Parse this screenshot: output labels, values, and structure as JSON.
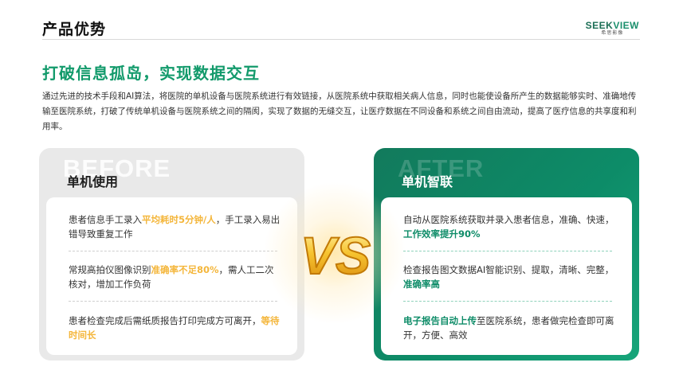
{
  "header": {
    "title": "产品优势",
    "logo": {
      "main_prefix": "SEEK",
      "main_suffix": "VIEW",
      "sub": "希思影像"
    }
  },
  "headline": "打破信息孤岛，实现数据交互",
  "intro": "通过先进的技术手段和AI算法，将医院的单机设备与医院系统进行有效链接，从医院系统中获取相关病人信息，同时也能使设备所产生的数据能够实时、准确地传输至医院系统，打破了传统单机设备与医院系统之间的隔阂，实现了数据的无缝交互，让医疗数据在不同设备和系统之间自由流动，提高了医疗信息的共享度和利用率。",
  "before": {
    "ghost": "BEFORE",
    "title": "单机使用",
    "items": [
      {
        "pre": "患者信息手工录入",
        "hl": "平均耗时5分钟/人",
        "post": "，手工录入易出错导致重复工作"
      },
      {
        "pre": "常规高拍仪图像识别",
        "hl": "准确率不足80%",
        "post": "，需人工二次核对，增加工作负荷"
      },
      {
        "pre": "患者检查完成后需纸质报告打印完成方可离开，",
        "hl": "等待时间长",
        "post": ""
      }
    ]
  },
  "after": {
    "ghost": "AFTER",
    "title": "单机智联",
    "items": [
      {
        "pre": "自动从医院系统获取并录入患者信息，准确、快速，",
        "hl": "工作效率提升90%",
        "post": ""
      },
      {
        "pre": "检查报告图文数据AI智能识别、提取，清晰、完整，",
        "hl": "准确率高",
        "post": ""
      },
      {
        "pre": "",
        "hl": "电子报告自动上传",
        "post": "至医院系统，患者做完检查即可离开，方便、高效"
      }
    ]
  },
  "vs_label": "VS",
  "colors": {
    "accent_green": "#129a6b",
    "highlight_orange": "#f4b63b",
    "panel_green": "#0d8c68"
  }
}
